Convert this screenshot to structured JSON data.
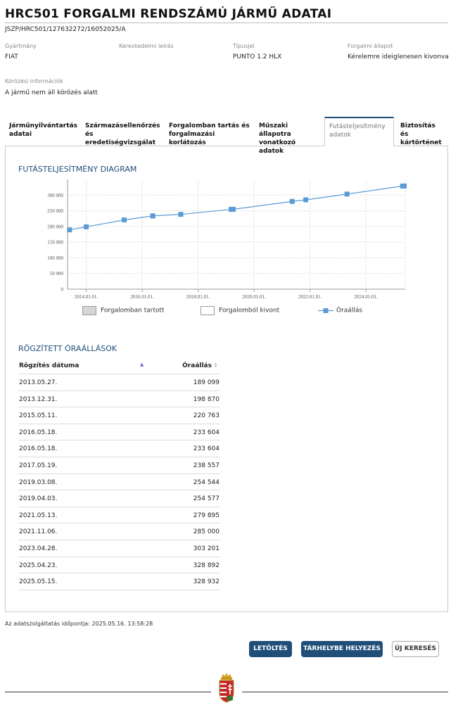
{
  "header": {
    "title": "HRC501 FORGALMI RENDSZÁMÚ JÁRMŰ ADATAI",
    "reference": "JSZP/HRC501/127632272/16052025/A"
  },
  "fields": [
    {
      "label": "Gyártmány",
      "value": "FIAT"
    },
    {
      "label": "Kereskedelmi leírás",
      "value": ""
    },
    {
      "label": "Típusjel",
      "value": "PUNTO 1.2 HLX"
    },
    {
      "label": "Forgalmi állapot",
      "value": "Kérelemre ideiglenesen kivonva"
    }
  ],
  "wanted": {
    "label": "Körözési információk",
    "value": "A jármű nem áll körözés alatt"
  },
  "tabs": [
    {
      "line1": "Járműnyilvántartás",
      "line2": "adatai",
      "active": false
    },
    {
      "line1": "Származásellenőrzés",
      "line2": "és eredetiségvizsgálat",
      "active": false
    },
    {
      "line1": "Forgalomban tartás és",
      "line2": "forgalmazási korlátozás",
      "active": false
    },
    {
      "line1": "Műszaki állapotra",
      "line2": "vonatkozó adatok",
      "active": false
    },
    {
      "line1": "Futásteljesítmény",
      "line2": "adatok",
      "active": true
    },
    {
      "line1": "Biztosítás és",
      "line2": "kártörténet",
      "active": false
    }
  ],
  "chart_section": {
    "title": "FUTÁSTELJESÍTMÉNY DIAGRAM"
  },
  "chart_data": {
    "type": "line",
    "title": "",
    "xlabel": "",
    "ylabel": "",
    "x_ticks": [
      "2014.01.01.",
      "2016.01.01.",
      "2018.01.01.",
      "2020.01.01.",
      "2022.01.01.",
      "2024.01.01."
    ],
    "y_ticks": [
      "0",
      "50 000",
      "100 000",
      "150 000",
      "200 000",
      "250 000",
      "300 000"
    ],
    "ylim": [
      0,
      300000
    ],
    "grid": true,
    "series": [
      {
        "name": "Óraállás",
        "color": "#5b9bd5",
        "x": [
          "2013-05-27",
          "2013-12-31",
          "2015-05-11",
          "2016-05-18",
          "2016-05-18",
          "2017-05-19",
          "2019-03-08",
          "2019-04-03",
          "2021-05-13",
          "2021-11-06",
          "2023-04-28",
          "2025-04-23",
          "2025-05-15"
        ],
        "values": [
          189099,
          198870,
          220763,
          233604,
          233604,
          238557,
          254544,
          254577,
          279895,
          285000,
          303201,
          328892,
          328932
        ]
      }
    ],
    "legend": [
      {
        "label": "Forgalomban tartott",
        "color": "#d6d6d6"
      },
      {
        "label": "Forgalomból kivont",
        "color": "#ffffff"
      },
      {
        "label": "Óraállás",
        "color": "#5b9bd5"
      }
    ]
  },
  "table_section": {
    "title": "RÖGZÍTETT ÓRAÁLLÁSOK"
  },
  "table": {
    "headers": {
      "date": "Rögzítés dátuma",
      "value": "Óraállás",
      "sort_asc_icon": "▲",
      "sort_icon": "⇕"
    },
    "rows": [
      {
        "date": "2013.05.27.",
        "value": "189 099"
      },
      {
        "date": "2013.12.31.",
        "value": "198 870"
      },
      {
        "date": "2015.05.11.",
        "value": "220 763"
      },
      {
        "date": "2016.05.18.",
        "value": "233 604"
      },
      {
        "date": "2016.05.18.",
        "value": "233 604"
      },
      {
        "date": "2017.05.19.",
        "value": "238 557"
      },
      {
        "date": "2019.03.08.",
        "value": "254 544"
      },
      {
        "date": "2019.04.03.",
        "value": "254 577"
      },
      {
        "date": "2021.05.13.",
        "value": "279 895"
      },
      {
        "date": "2021.11.06.",
        "value": "285 000"
      },
      {
        "date": "2023.04.28.",
        "value": "303 201"
      },
      {
        "date": "2025.04.23.",
        "value": "328 892"
      },
      {
        "date": "2025.05.15.",
        "value": "328 932"
      }
    ]
  },
  "timestamp": "Az adatszolgáltatás időpontja: 2025.05.16. 13:58:28",
  "buttons": {
    "download": "LETÖLTÉS",
    "store": "TÁRHELYBE HELYEZÉS",
    "new_search": "ÚJ KERESÉS"
  },
  "colors": {
    "accent": "#1f4e79",
    "series": "#5b9bd5"
  },
  "footer": {
    "crest_icon": "hungarian-coat-of-arms-icon"
  }
}
